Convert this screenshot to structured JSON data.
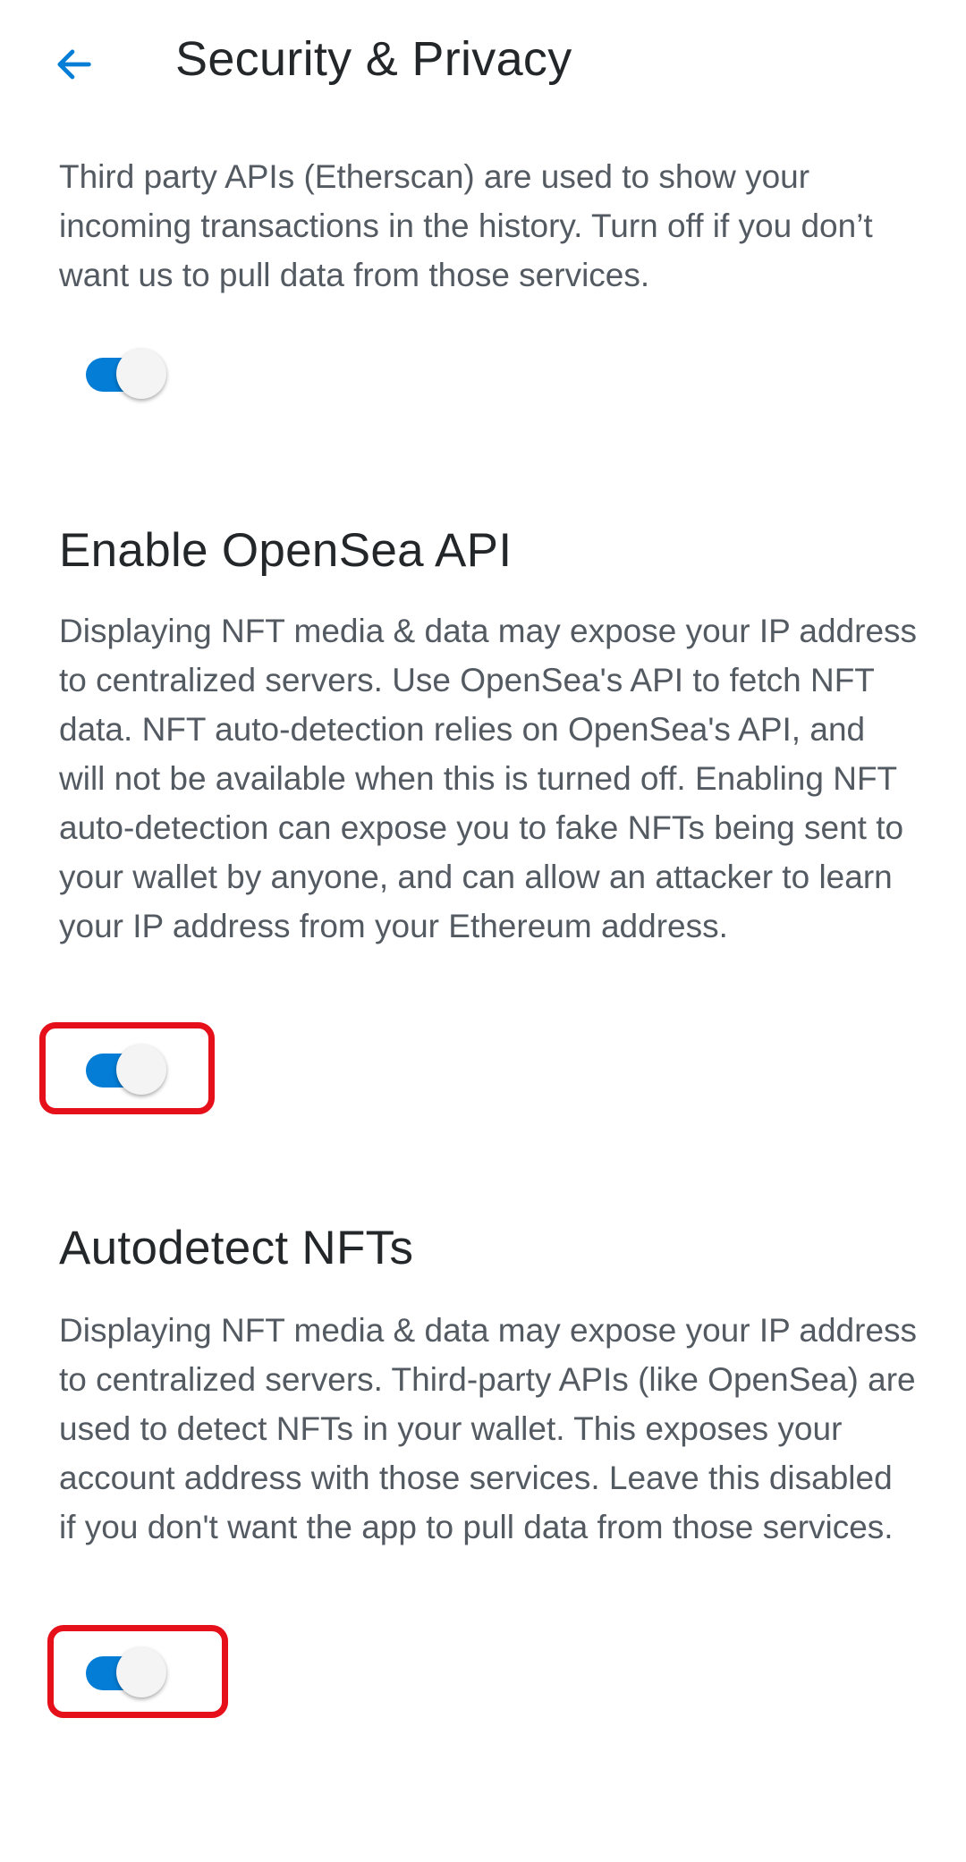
{
  "header": {
    "title": "Security & Privacy",
    "back_icon": "arrow-left-icon",
    "accent_color": "#037dd6"
  },
  "sections": {
    "incoming_tx": {
      "description": "Third party APIs (Etherscan) are used to show your incoming transactions in the history. Turn off if you don’t want us to pull data from those services.",
      "toggle_on": true
    },
    "opensea": {
      "title": "Enable OpenSea API",
      "description": "Displaying NFT media & data may expose your IP address to centralized servers. Use OpenSea's API to fetch NFT data. NFT auto-detection relies on OpenSea's API, and will not be available when this is turned off. Enabling NFT auto-detection can expose you to fake NFTs being sent to your wallet by anyone, and can allow an attacker to learn your IP address from your Ethereum address.",
      "toggle_on": true
    },
    "autodetect": {
      "title": "Autodetect NFTs",
      "description": "Displaying NFT media & data may expose your IP address to centralized servers. Third-party APIs (like OpenSea) are used to detect NFTs in your wallet. This exposes your account address with those services. Leave this disabled if you don't want the app to pull data from those services.",
      "toggle_on": true
    }
  },
  "highlight_color": "#e5101a"
}
